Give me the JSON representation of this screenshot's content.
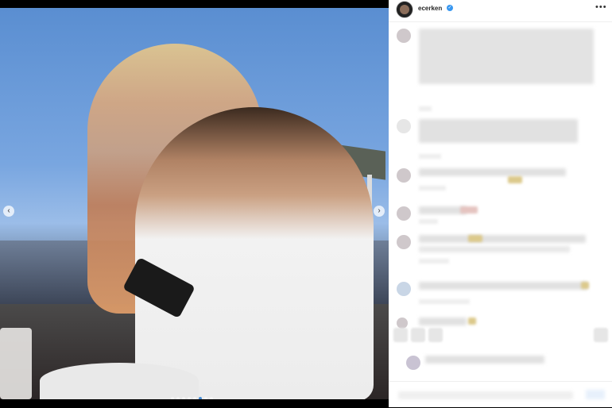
{
  "post": {
    "username": "ecerken",
    "verified_symbol": "✓",
    "more_label": "•••",
    "prev_arrow": "‹",
    "next_arrow": "›",
    "carousel": {
      "total": 8,
      "active_index": 5
    }
  },
  "colors": {
    "verified": "#3897f0",
    "active_dot": "#4a90d9",
    "background": "#000000",
    "panel": "#ffffff"
  },
  "icons": [
    "more-icon",
    "verified-icon",
    "prev-arrow-icon",
    "next-arrow-icon"
  ]
}
